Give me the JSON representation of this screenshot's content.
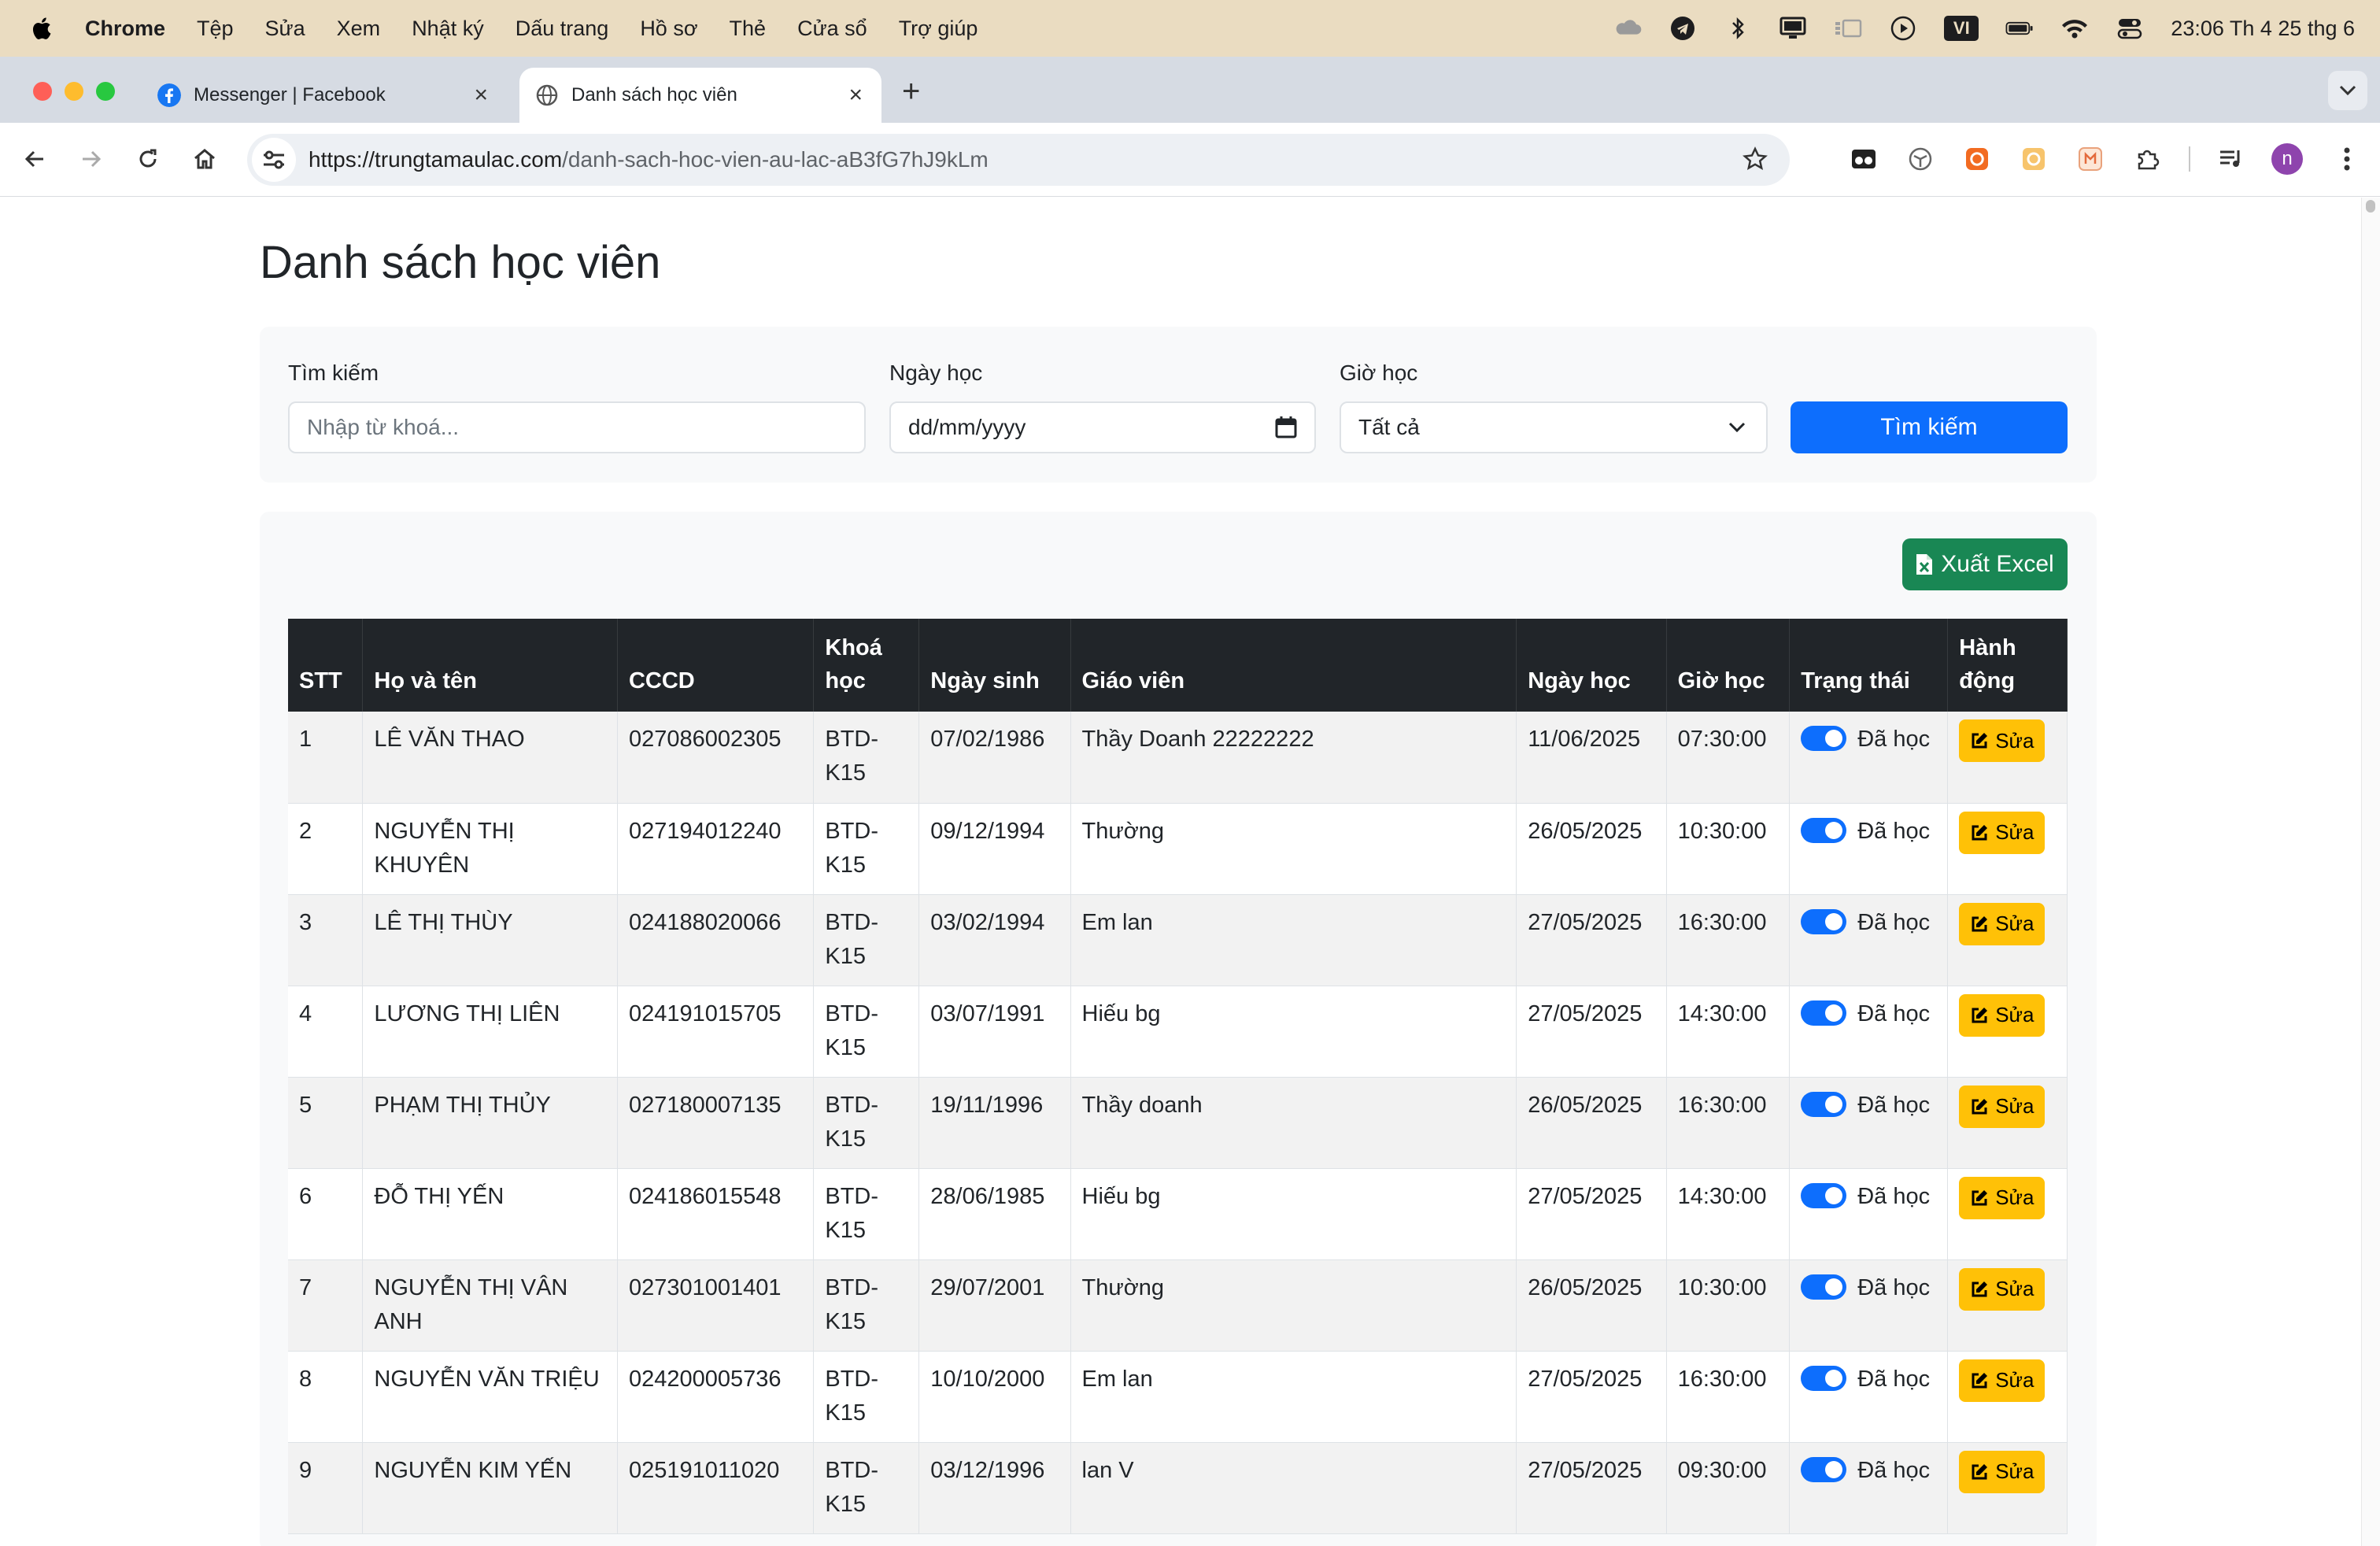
{
  "menubar": {
    "app": "Chrome",
    "items": [
      "Tệp",
      "Sửa",
      "Xem",
      "Nhật ký",
      "Dấu trang",
      "Hồ sơ",
      "Thẻ",
      "Cửa sổ",
      "Trợ giúp"
    ],
    "input_source": "VI",
    "clock": "23:06 Th 4 25 thg 6"
  },
  "browser": {
    "tabs": [
      {
        "title": "Messenger | Facebook"
      },
      {
        "title": "Danh sách học viên"
      }
    ],
    "url_host": "https://trungtamaulac.com",
    "url_path": "/danh-sach-hoc-vien-au-lac-aB3fG7hJ9kLm",
    "profile_initial": "n"
  },
  "page": {
    "title": "Danh sách học viên",
    "filters": {
      "search_label": "Tìm kiếm",
      "search_placeholder": "Nhập từ khoá...",
      "date_label": "Ngày học",
      "date_value": "dd/mm/yyyy",
      "time_label": "Giờ học",
      "time_value": "Tất cả",
      "search_button": "Tìm kiếm"
    },
    "export_button": "Xuất Excel",
    "table": {
      "headers": [
        "STT",
        "Họ và tên",
        "CCCD",
        "Khoá học",
        "Ngày sinh",
        "Giáo viên",
        "Ngày học",
        "Giờ học",
        "Trạng thái",
        "Hành động"
      ],
      "rows": [
        {
          "stt": "1",
          "name": "LÊ VĂN THAO",
          "cccd": "027086002305",
          "course": "BTD-K15",
          "dob": "07/02/1986",
          "teacher": "Thầy Doanh 22222222",
          "date": "11/06/2025",
          "time": "07:30:00",
          "status": "Đã học",
          "action": "Sửa"
        },
        {
          "stt": "2",
          "name": "NGUYỄN THỊ KHUYÊN",
          "cccd": "027194012240",
          "course": "BTD-K15",
          "dob": "09/12/1994",
          "teacher": "Thường",
          "date": "26/05/2025",
          "time": "10:30:00",
          "status": "Đã học",
          "action": "Sửa"
        },
        {
          "stt": "3",
          "name": "LÊ THỊ THÙY",
          "cccd": "024188020066",
          "course": "BTD-K15",
          "dob": "03/02/1994",
          "teacher": "Em lan",
          "date": "27/05/2025",
          "time": "16:30:00",
          "status": "Đã học",
          "action": "Sửa"
        },
        {
          "stt": "4",
          "name": "LƯƠNG THỊ LIÊN",
          "cccd": "024191015705",
          "course": "BTD-K15",
          "dob": "03/07/1991",
          "teacher": "Hiếu bg",
          "date": "27/05/2025",
          "time": "14:30:00",
          "status": "Đã học",
          "action": "Sửa"
        },
        {
          "stt": "5",
          "name": "PHẠM THỊ THỦY",
          "cccd": "027180007135",
          "course": "BTD-K15",
          "dob": "19/11/1996",
          "teacher": "Thầy doanh",
          "date": "26/05/2025",
          "time": "16:30:00",
          "status": "Đã học",
          "action": "Sửa"
        },
        {
          "stt": "6",
          "name": "ĐỖ THỊ YẾN",
          "cccd": "024186015548",
          "course": "BTD-K15",
          "dob": "28/06/1985",
          "teacher": "Hiếu bg",
          "date": "27/05/2025",
          "time": "14:30:00",
          "status": "Đã học",
          "action": "Sửa"
        },
        {
          "stt": "7",
          "name": "NGUYỄN THỊ VÂN ANH",
          "cccd": "027301001401",
          "course": "BTD-K15",
          "dob": "29/07/2001",
          "teacher": "Thường",
          "date": "26/05/2025",
          "time": "10:30:00",
          "status": "Đã học",
          "action": "Sửa"
        },
        {
          "stt": "8",
          "name": "NGUYỄN VĂN TRIỆU",
          "cccd": "024200005736",
          "course": "BTD-K15",
          "dob": "10/10/2000",
          "teacher": "Em lan",
          "date": "27/05/2025",
          "time": "16:30:00",
          "status": "Đã học",
          "action": "Sửa"
        },
        {
          "stt": "9",
          "name": "NGUYỄN KIM YẾN",
          "cccd": "025191011020",
          "course": "BTD-K15",
          "dob": "03/12/1996",
          "teacher": "lan V",
          "date": "27/05/2025",
          "time": "09:30:00",
          "status": "Đã học",
          "action": "Sửa"
        }
      ]
    }
  },
  "colors": {
    "menubar": "#eadcc1",
    "primary": "#0d6efd",
    "success": "#198754",
    "warning": "#ffc107",
    "table_header": "#212529"
  },
  "icons": [
    "apple-icon",
    "cloud-icon",
    "telegram-icon",
    "bluetooth-icon",
    "display-icon",
    "stage-manager-icon",
    "play-icon",
    "battery-icon",
    "wifi-icon",
    "control-center-icon",
    "back-icon",
    "forward-icon",
    "reload-icon",
    "home-icon",
    "site-settings-icon",
    "star-icon",
    "extensions-icon",
    "media-icon",
    "menu-icon",
    "calendar-icon",
    "chevron-down-icon",
    "file-excel-icon",
    "edit-icon"
  ]
}
